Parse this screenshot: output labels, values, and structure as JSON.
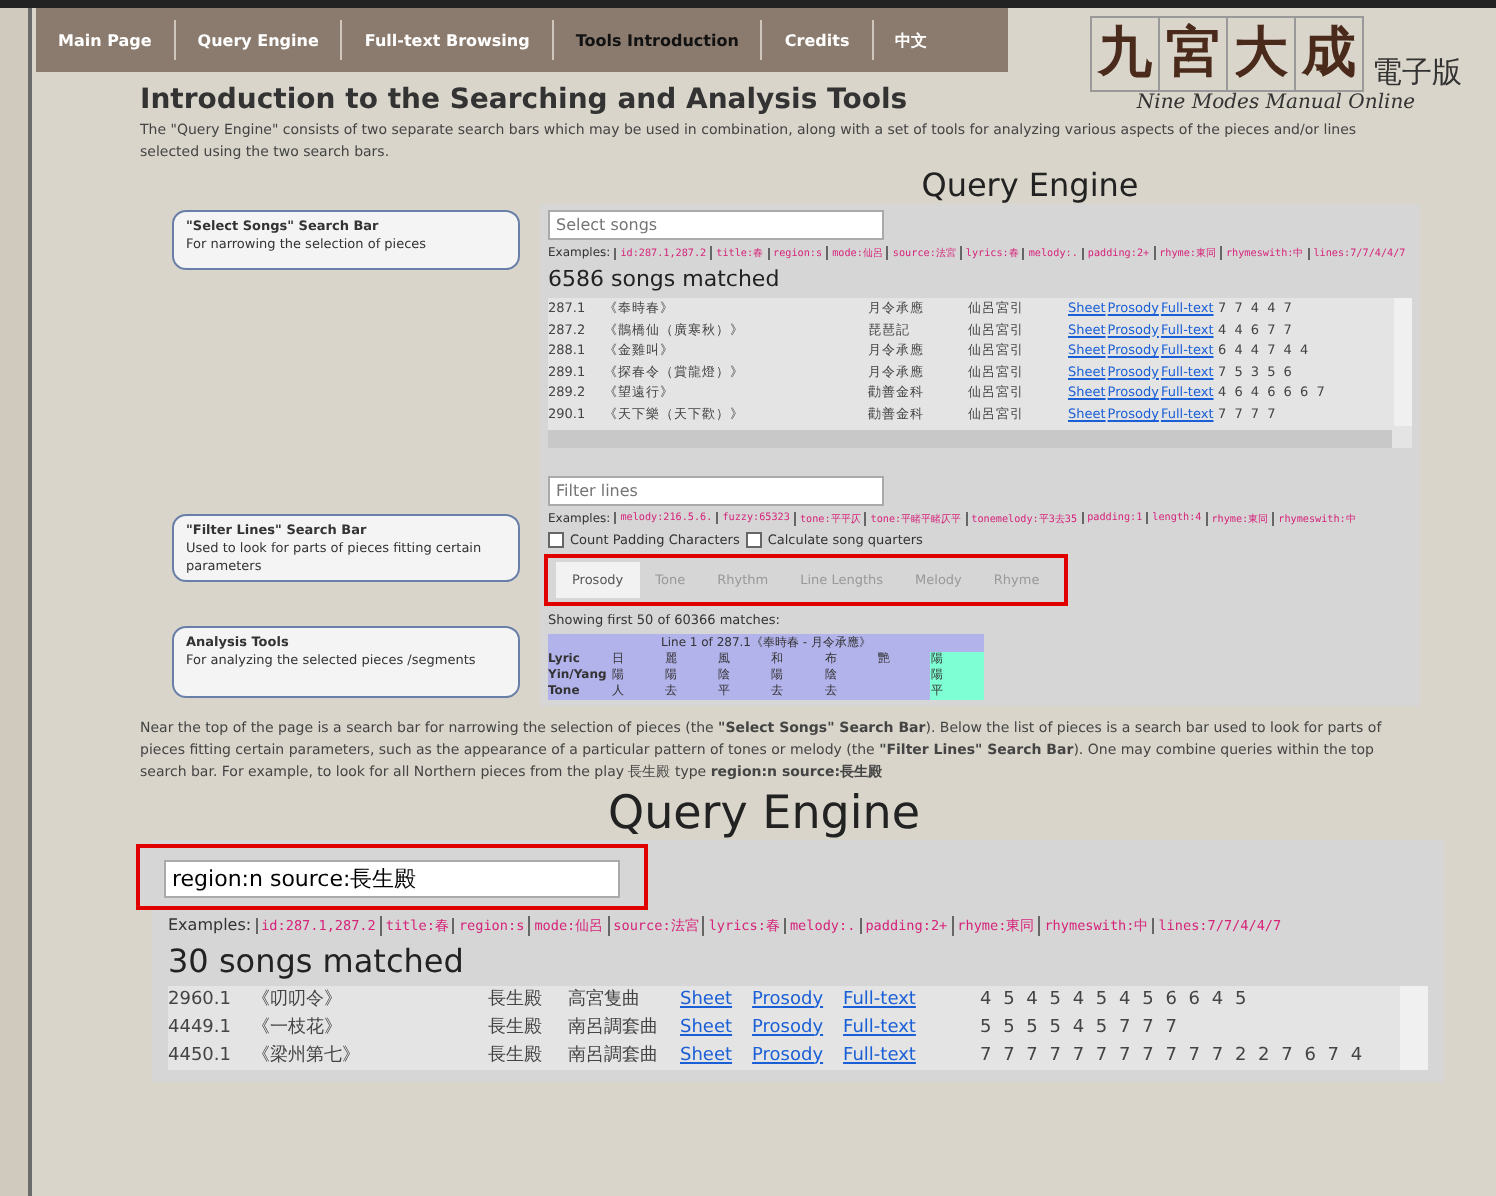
{
  "nav": [
    {
      "label": "Main Page",
      "selected": false
    },
    {
      "label": "Query Engine",
      "selected": false
    },
    {
      "label": "Full-text Browsing",
      "selected": false
    },
    {
      "label": "Tools Introduction",
      "selected": true
    },
    {
      "label": "Credits",
      "selected": false
    },
    {
      "label": "中文",
      "selected": false
    }
  ],
  "logo": {
    "characters": [
      "九",
      "宮",
      "大",
      "成"
    ],
    "suffix": "電子版",
    "subtitle": "Nine Modes Manual Online"
  },
  "title": "Introduction to the Searching and Analysis Tools",
  "intro": "The \"Query Engine\" consists of two separate search bars which may be used in combination, along with a set of tools for analyzing various aspects of the pieces and/or lines selected using the two search bars.",
  "callouts": [
    {
      "title": "\"Select Songs\" Search Bar",
      "text": "For narrowing the selection of pieces"
    },
    {
      "title": "\"Filter Lines\" Search Bar",
      "text": "Used to look for parts of pieces fitting certain parameters"
    },
    {
      "title": "Analysis Tools",
      "text": "For analyzing the selected pieces /segments"
    }
  ],
  "screenshot": {
    "heading": "Query Engine",
    "song_search": {
      "placeholder": "Select songs"
    },
    "examples_label": "Examples:",
    "examples": [
      "id:287.1,287.2",
      "title:春",
      "region:s",
      "mode:仙呂",
      "source:法宮",
      "lyrics:春",
      "melody:.",
      "padding:2+",
      "rhyme:東同",
      "rhymeswith:中",
      "lines:7/7/4/4/7"
    ],
    "matched": "6586 songs matched",
    "songs": [
      {
        "id": "287.1",
        "title": "《奉時春》",
        "source": "月令承應",
        "mode": "仙呂宮引",
        "links": [
          "Sheet",
          "Prosody",
          "Full-text"
        ],
        "lengths": "7 7 4 4 7"
      },
      {
        "id": "287.2",
        "title": "《鵲橋仙（廣寒秋）》",
        "source": "琵琶記",
        "mode": "仙呂宮引",
        "links": [
          "Sheet",
          "Prosody",
          "Full-text"
        ],
        "lengths": "4 4 6 7 7"
      },
      {
        "id": "288.1",
        "title": "《金雞叫》",
        "source": "月令承應",
        "mode": "仙呂宮引",
        "links": [
          "Sheet",
          "Prosody",
          "Full-text"
        ],
        "lengths": "6 4 4 7 4 4"
      },
      {
        "id": "289.1",
        "title": "《探春令（賞龍燈）》",
        "source": "月令承應",
        "mode": "仙呂宮引",
        "links": [
          "Sheet",
          "Prosody",
          "Full-text"
        ],
        "lengths": "7 5 3 5 6"
      },
      {
        "id": "289.2",
        "title": "《望遠行》",
        "source": "勸善金科",
        "mode": "仙呂宮引",
        "links": [
          "Sheet",
          "Prosody",
          "Full-text"
        ],
        "lengths": "4 6 4 6 6 6 7"
      },
      {
        "id": "290.1",
        "title": "《天下樂（天下歡）》",
        "source": "勸善金科",
        "mode": "仙呂宮引",
        "links": [
          "Sheet",
          "Prosody",
          "Full-text"
        ],
        "lengths": "7 7 7 7"
      }
    ],
    "line_search": {
      "placeholder": "Filter lines"
    },
    "line_examples_label": "Examples:",
    "line_examples": [
      "melody:216.5.6.",
      "fuzzy:65323",
      "tone:平平仄",
      "tone:平睹平睹仄平",
      "tonemelody:平3去35",
      "padding:1",
      "length:4",
      "rhyme:東同",
      "rhymeswith:中"
    ],
    "options": [
      {
        "label": "Count Padding Characters",
        "checked": false
      },
      {
        "label": "Calculate song quarters",
        "checked": false
      }
    ],
    "tabs": [
      {
        "label": "Prosody",
        "selected": true
      },
      {
        "label": "Tone",
        "selected": false
      },
      {
        "label": "Rhythm",
        "selected": false
      },
      {
        "label": "Line Lengths",
        "selected": false
      },
      {
        "label": "Melody",
        "selected": false
      },
      {
        "label": "Rhyme",
        "selected": false
      }
    ],
    "showing": "Showing first 50 of 60366 matches:",
    "prosody": {
      "caption": "Line 1 of 287.1《奉時春 - 月令承應》",
      "rows": [
        {
          "label": "Lyric",
          "cells": [
            {
              "text": "日",
              "rhyme": false
            },
            {
              "text": "麗",
              "rhyme": false
            },
            {
              "text": "風",
              "rhyme": false
            },
            {
              "text": "和",
              "rhyme": false
            },
            {
              "text": "布",
              "rhyme": false
            },
            {
              "text": "艷",
              "rhyme": false
            },
            {
              "text": "陽",
              "rhyme": true
            }
          ]
        },
        {
          "label": "Yin/Yang",
          "cells": [
            {
              "text": "陽",
              "rhyme": false
            },
            {
              "text": "陽",
              "rhyme": false
            },
            {
              "text": "陰",
              "rhyme": false
            },
            {
              "text": "陽",
              "rhyme": false
            },
            {
              "text": "陰",
              "rhyme": false
            },
            {
              "text": "",
              "rhyme": false
            },
            {
              "text": "陽",
              "rhyme": true
            }
          ]
        },
        {
          "label": "Tone",
          "cells": [
            {
              "text": "人",
              "rhyme": false
            },
            {
              "text": "去",
              "rhyme": false
            },
            {
              "text": "平",
              "rhyme": false
            },
            {
              "text": "去",
              "rhyme": false
            },
            {
              "text": "去",
              "rhyme": false
            },
            {
              "text": "",
              "rhyme": false
            },
            {
              "text": "平",
              "rhyme": true
            }
          ]
        }
      ]
    }
  },
  "explanation": "Near the top of the page is a search bar for narrowing the selection of pieces (the **\"Select Songs\" Search Bar**). Below the list of pieces is a search bar used to look for parts of pieces fitting certain parameters, such as the appearance of a particular pattern of tones or melody (the **\"Filter Lines\" Search Bar**). One may combine queries within the top search bar. For example, to look for all Northern pieces from the play 長生殿 type **region:n source:長生殿**",
  "example_screenshot": {
    "heading": "Query Engine",
    "song_search": {
      "value": "region:n source:長生殿"
    },
    "examples_label": "Examples:",
    "examples": [
      "id:287.1,287.2",
      "title:春",
      "region:s",
      "mode:仙呂",
      "source:法宮",
      "lyrics:春",
      "melody:.",
      "padding:2+",
      "rhyme:東同",
      "rhymeswith:中",
      "lines:7/7/4/4/7"
    ],
    "matched": "30 songs matched",
    "songs": [
      {
        "id": "2960.1",
        "title": "《叨叨令》",
        "source": "長生殿",
        "mode": "高宮隻曲",
        "links": [
          "Sheet",
          "Prosody",
          "Full-text"
        ],
        "lengths": "4 5 4 5 4 5 4 5 6 6 4 5"
      },
      {
        "id": "4449.1",
        "title": "《一枝花》",
        "source": "長生殿",
        "mode": "南呂調套曲",
        "links": [
          "Sheet",
          "Prosody",
          "Full-text"
        ],
        "lengths": "5 5 5 5 4 5 7 7 7"
      },
      {
        "id": "4450.1",
        "title": "《梁州第七》",
        "source": "長生殿",
        "mode": "南呂調套曲",
        "links": [
          "Sheet",
          "Prosody",
          "Full-text"
        ],
        "lengths": "7 7 7 7 7 7 7 7 7 7 7 2 2 7 6 7 4"
      }
    ]
  }
}
